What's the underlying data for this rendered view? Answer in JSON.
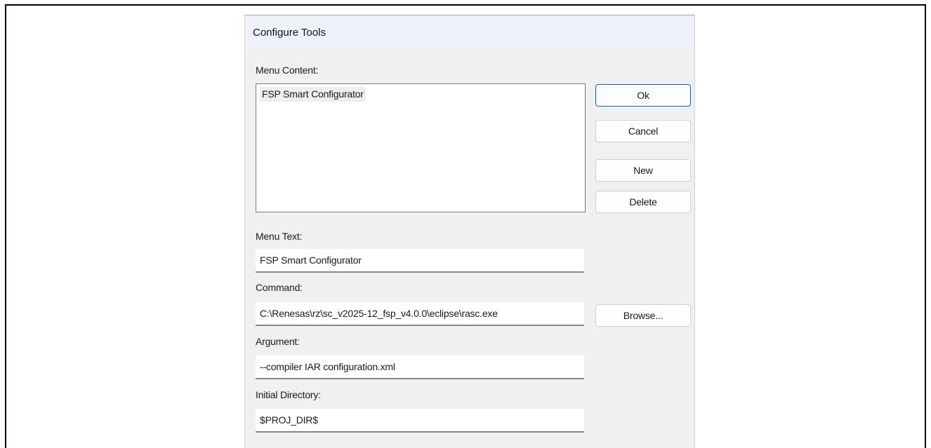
{
  "dialog": {
    "title": "Configure Tools",
    "menu_content_label": "Menu Content:",
    "menu_items": [
      "FSP Smart Configurator"
    ],
    "buttons": {
      "ok": "Ok",
      "cancel": "Cancel",
      "new": "New",
      "delete": "Delete",
      "browse": "Browse..."
    },
    "menu_text": {
      "label": "Menu Text:",
      "value": "FSP Smart Configurator"
    },
    "command": {
      "label": "Command:",
      "value": "C:\\Renesas\\rz\\sc_v2025-12_fsp_v4.0.0\\eclipse\\rasc.exe"
    },
    "argument": {
      "label": "Argument:",
      "value": "--compiler IAR configuration.xml"
    },
    "initial_directory": {
      "label": "Initial Directory:",
      "value": "$PROJ_DIR$"
    }
  },
  "colors": {
    "dialog_bg": "#f0f0f0",
    "titlebar_bg": "#eef1f9",
    "default_button_border": "#0067c0"
  }
}
